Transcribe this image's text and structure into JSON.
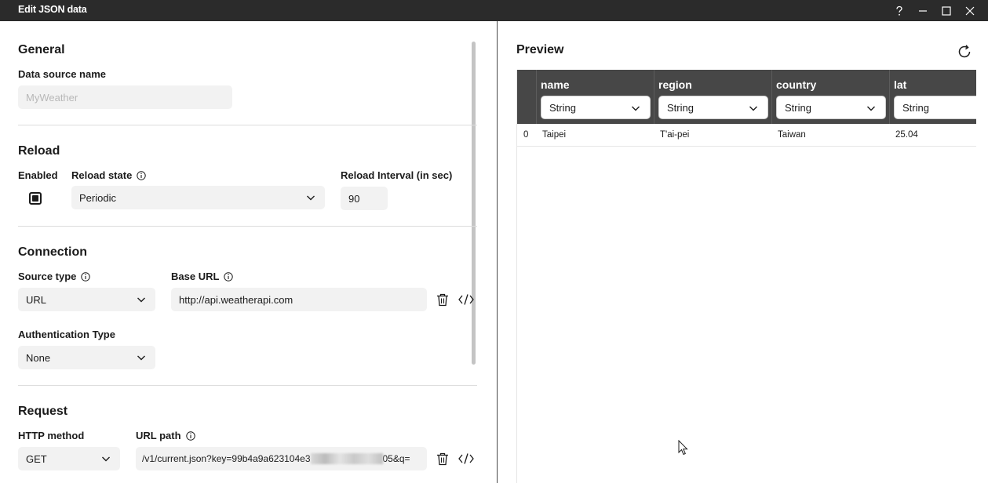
{
  "window": {
    "title": "Edit JSON data",
    "controls": [
      "help-icon",
      "minimize-icon",
      "maximize-icon",
      "close-icon"
    ]
  },
  "general": {
    "heading": "General",
    "data_source_label": "Data source name",
    "data_source_placeholder": "MyWeather"
  },
  "reload": {
    "heading": "Reload",
    "enabled_label": "Enabled",
    "enabled_checked": true,
    "state_label": "Reload state",
    "state_value": "Periodic",
    "interval_label": "Reload Interval (in sec)",
    "interval_value": "90"
  },
  "connection": {
    "heading": "Connection",
    "source_type_label": "Source type",
    "source_type_value": "URL",
    "base_url_label": "Base URL",
    "base_url_value": "http://api.weatherapi.com",
    "auth_label": "Authentication Type",
    "auth_value": "None"
  },
  "request": {
    "heading": "Request",
    "method_label": "HTTP method",
    "method_value": "GET",
    "url_path_label": "URL path",
    "url_path_prefix": "/v1/current.json?key=99b4a9a623104e3",
    "url_path_suffix": "05&q="
  },
  "preview": {
    "heading": "Preview",
    "columns": [
      {
        "name": "name",
        "type": "String"
      },
      {
        "name": "region",
        "type": "String"
      },
      {
        "name": "country",
        "type": "String"
      },
      {
        "name": "lat",
        "type": "String"
      }
    ],
    "rows": [
      {
        "index": "0",
        "cells": [
          "Taipei",
          "T'ai-pei",
          "Taiwan",
          "25.04"
        ]
      }
    ]
  }
}
